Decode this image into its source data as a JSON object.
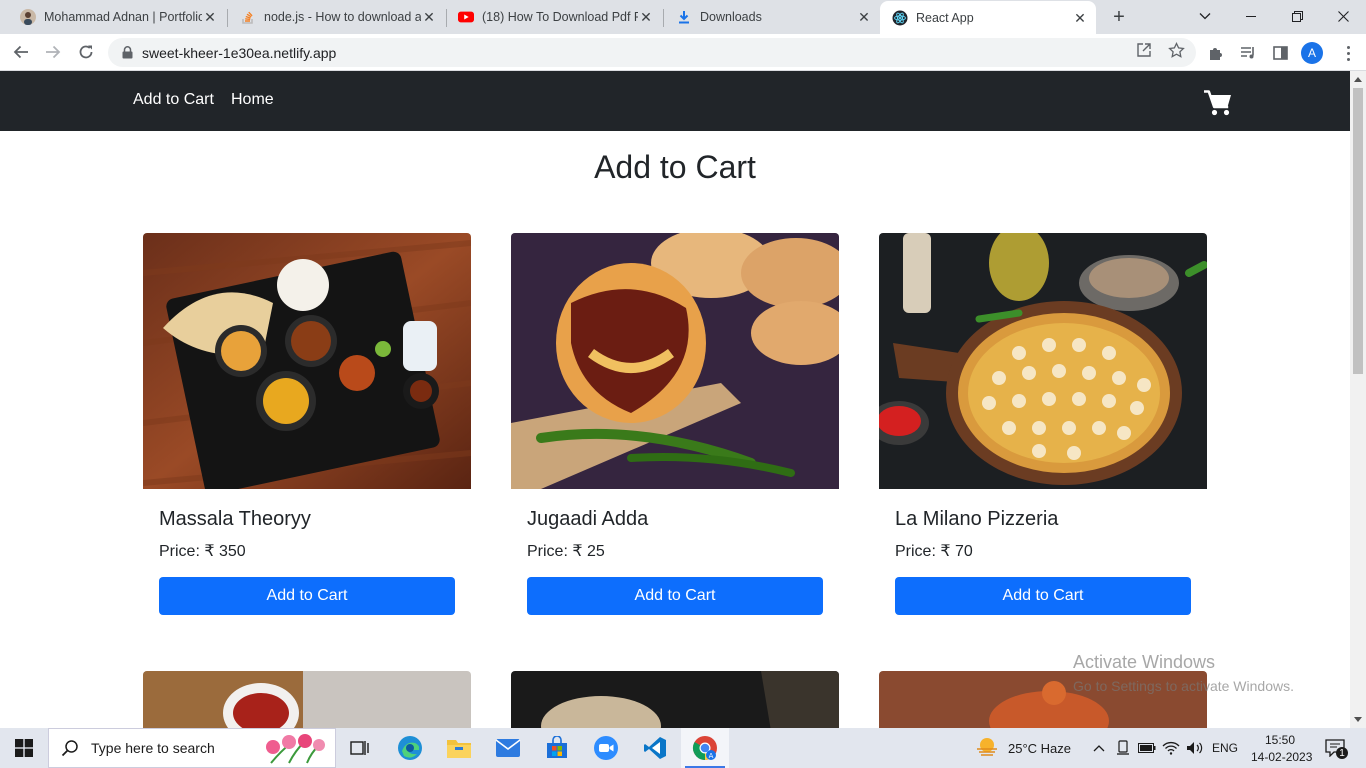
{
  "browser": {
    "tabs": [
      {
        "title": "Mohammad Adnan | Portfolio",
        "icon": "profile-photo-favicon"
      },
      {
        "title": "node.js - How to download a",
        "icon": "stackoverflow-icon"
      },
      {
        "title": "(18) How To Download Pdf Fi",
        "icon": "youtube-icon"
      },
      {
        "title": "Downloads",
        "icon": "download-icon"
      },
      {
        "title": "React App",
        "icon": "react-icon"
      }
    ],
    "url": "sweet-kheer-1e30ea.netlify.app",
    "profile_initial": "A"
  },
  "nav": {
    "link_cart": "Add to Cart",
    "link_home": "Home"
  },
  "page": {
    "title": "Add to Cart"
  },
  "products": [
    {
      "name": "Massala Theoryy",
      "price": "Price: ₹ 350",
      "button": "Add to Cart"
    },
    {
      "name": "Jugaadi Adda",
      "price": "Price: ₹ 25",
      "button": "Add to Cart"
    },
    {
      "name": "La Milano Pizzeria",
      "price": "Price: ₹ 70",
      "button": "Add to Cart"
    }
  ],
  "watermark": {
    "heading": "Activate Windows",
    "sub": "Go to Settings to activate Windows."
  },
  "taskbar": {
    "search_placeholder": "Type here to search",
    "weather": "25°C  Haze",
    "language": "ENG",
    "time": "15:50",
    "date": "14-02-2023",
    "notifications": "1"
  },
  "colors": {
    "navbar": "#212529",
    "primary": "#0d6efd"
  }
}
